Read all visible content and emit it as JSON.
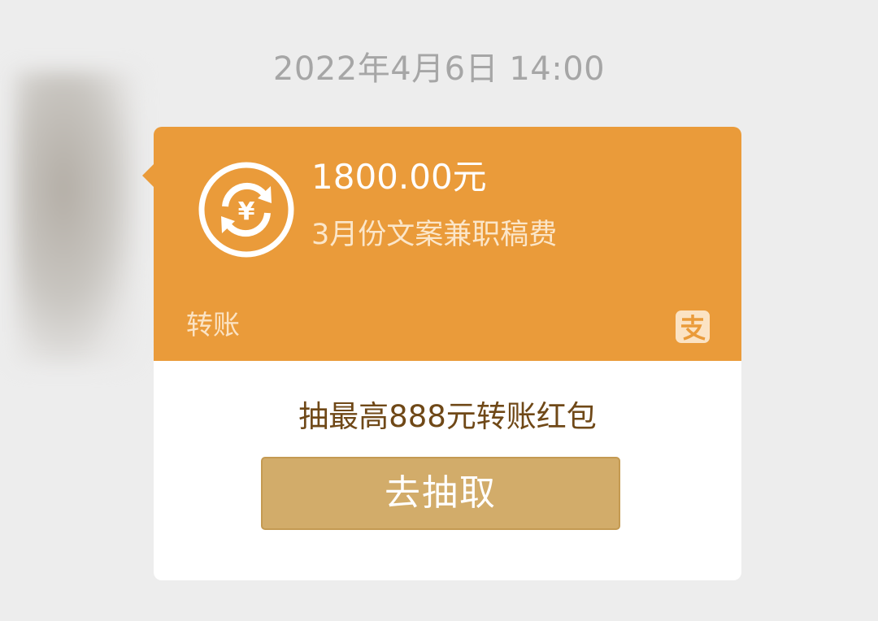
{
  "timestamp": "2022年4月6日 14:00",
  "transfer_card": {
    "icon": "yuan-transfer-icon",
    "amount": "1800.00元",
    "memo": "3月份文案兼职稿费",
    "type_label": "转账",
    "brand_icon": "alipay-icon",
    "accent_color": "#ea9b3a"
  },
  "promo": {
    "text": "抽最高888元转账红包",
    "button_label": "去抽取",
    "button_color": "#d2ac6a"
  }
}
